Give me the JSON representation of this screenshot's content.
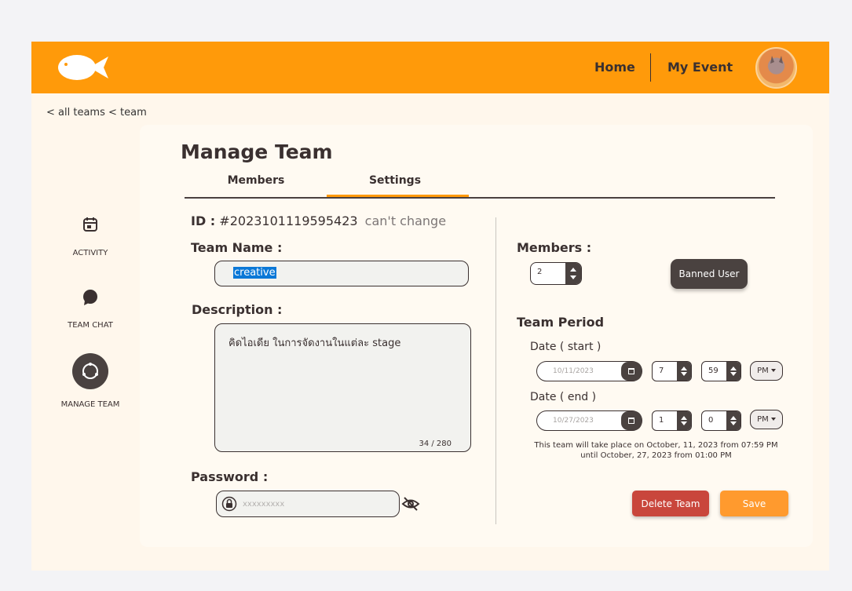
{
  "header": {
    "logo": "fish-logo",
    "nav": {
      "home": "Home",
      "my_event": "My Event"
    },
    "avatar": "user-avatar",
    "accent_color": "#ff9a0a"
  },
  "breadcrumb": "< all teams < team",
  "sidebar": {
    "items": [
      {
        "label": "ACTIVITY",
        "icon": "calendar-icon"
      },
      {
        "label": "TEAM CHAT",
        "icon": "chat-bubble-icon"
      },
      {
        "label": "MANAGE TEAM",
        "icon": "manage-circle-icon",
        "active": true
      }
    ]
  },
  "main": {
    "title": "Manage Team",
    "tabs": [
      {
        "label": "Members",
        "active": false
      },
      {
        "label": "Settings",
        "active": true
      }
    ],
    "id_label": "ID :",
    "id_value": "#2023101119595423",
    "id_note": "can't change",
    "team_name_label": "Team Name :",
    "team_name_value": "creative",
    "description_label": "Description :",
    "description_value": "คิดไอเดีย ในการจัดงานในแต่ละ stage",
    "description_count": "34 / 280",
    "password_label": "Password :",
    "password_placeholder": "xxxxxxxxx",
    "members_label": "Members :",
    "members_value": "2",
    "banned_button": "Banned User",
    "period_label": "Team Period",
    "start_label": "Date ( start )",
    "start_date": "10/11/2023",
    "start_hour": "7",
    "start_minute": "59",
    "start_ampm": "PM",
    "end_label": "Date ( end )",
    "end_date": "10/27/2023",
    "end_hour": "1",
    "end_minute": "0",
    "end_ampm": "PM",
    "period_note_line1": "This team will take place on October, 11, 2023 from 07:59 PM",
    "period_note_line2": "until October, 27, 2023 from 01:00 PM",
    "delete_button": "Delete Team",
    "save_button": "Save"
  }
}
